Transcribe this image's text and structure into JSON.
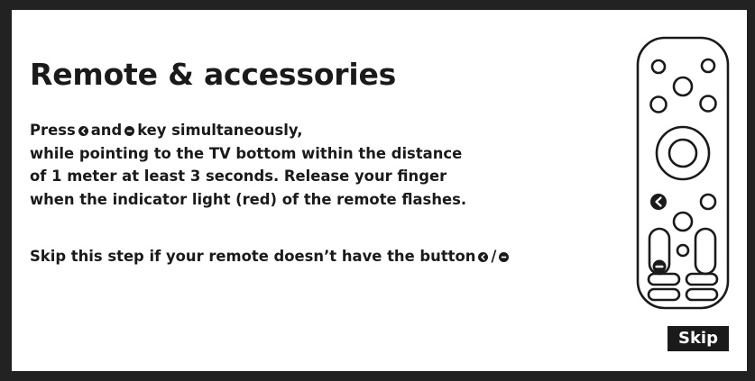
{
  "page": {
    "title": "Remote & accessories"
  },
  "instructions": {
    "line1_before": "Press",
    "line1_middle": "and",
    "line1_after": "key simultaneously,",
    "line2": "while pointing to the TV bottom within the distance",
    "line3": "of 1 meter at least 3 seconds. Release your finger",
    "line4": "when the indicator light (red) of the remote flashes."
  },
  "skip_note": {
    "text": "Skip this step if your remote doesn’t have the button",
    "separator": "/"
  },
  "icons": {
    "back_key": "back-arrow-icon",
    "minus_key": "minus-key-icon"
  },
  "actions": {
    "skip_label": "Skip"
  },
  "colors": {
    "frame": "#222222",
    "text": "#1a1a1a",
    "button_bg": "#1a1a1a",
    "button_text": "#ffffff",
    "background": "#ffffff"
  }
}
